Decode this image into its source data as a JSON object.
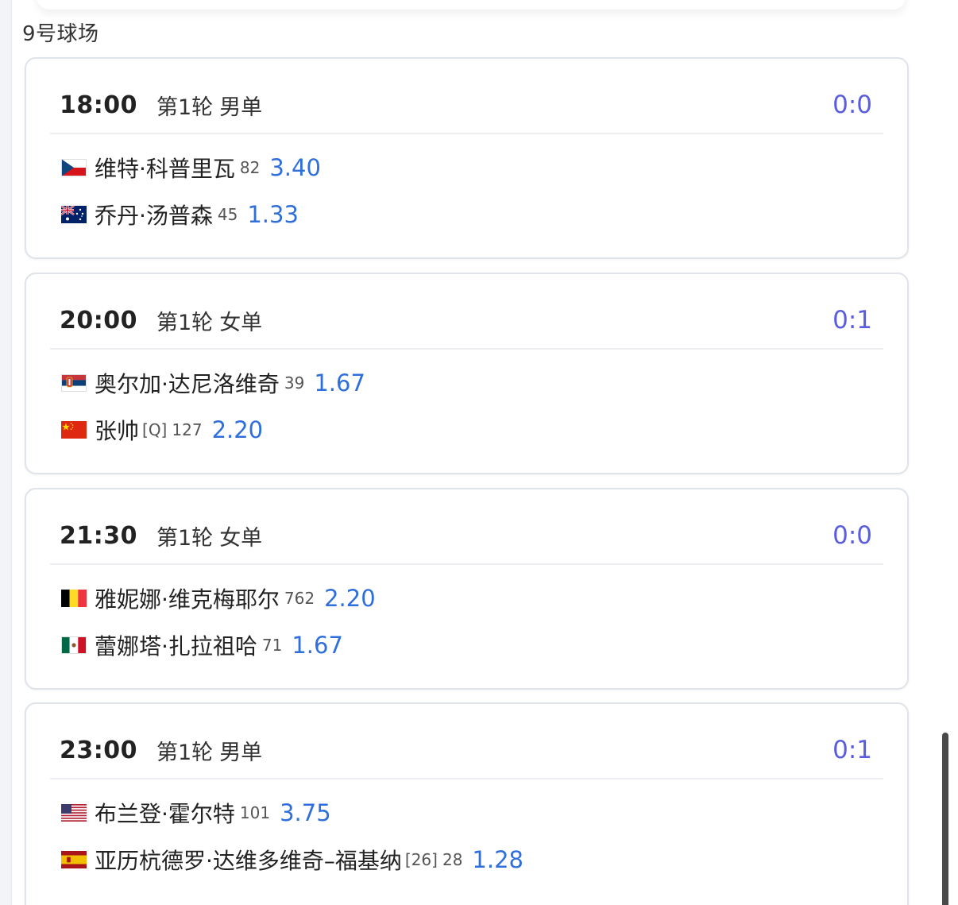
{
  "court": {
    "title": "9号球场"
  },
  "colors": {
    "score": "#5a5de0",
    "odds": "#2f6fdb",
    "border": "#dfe3ea"
  },
  "matches": [
    {
      "time": "18:00",
      "round": "第1轮",
      "event": "男单",
      "score": "0:0",
      "players": [
        {
          "flag": "czech-flag-icon",
          "name": "维特·科普里瓦",
          "seed": "",
          "rank": "82",
          "odds": "3.40"
        },
        {
          "flag": "australia-flag-icon",
          "name": "乔丹·汤普森",
          "seed": "",
          "rank": "45",
          "odds": "1.33"
        }
      ]
    },
    {
      "time": "20:00",
      "round": "第1轮",
      "event": "女单",
      "score": "0:1",
      "players": [
        {
          "flag": "serbia-flag-icon",
          "name": "奥尔加·达尼洛维奇",
          "seed": "",
          "rank": "39",
          "odds": "1.67"
        },
        {
          "flag": "china-flag-icon",
          "name": "张帅",
          "seed": "[Q]",
          "rank": "127",
          "odds": "2.20"
        }
      ]
    },
    {
      "time": "21:30",
      "round": "第1轮",
      "event": "女单",
      "score": "0:0",
      "players": [
        {
          "flag": "belgium-flag-icon",
          "name": "雅妮娜·维克梅耶尔",
          "seed": "",
          "rank": "762",
          "odds": "2.20"
        },
        {
          "flag": "mexico-flag-icon",
          "name": "蕾娜塔·扎拉祖哈",
          "seed": "",
          "rank": "71",
          "odds": "1.67"
        }
      ]
    },
    {
      "time": "23:00",
      "round": "第1轮",
      "event": "男单",
      "score": "0:1",
      "players": [
        {
          "flag": "usa-flag-icon",
          "name": "布兰登·霍尔特",
          "seed": "",
          "rank": "101",
          "odds": "3.75"
        },
        {
          "flag": "spain-flag-icon",
          "name": "亚历杭德罗·达维多维奇–福基纳",
          "seed": "[26]",
          "rank": "28",
          "odds": "1.28"
        }
      ]
    }
  ]
}
